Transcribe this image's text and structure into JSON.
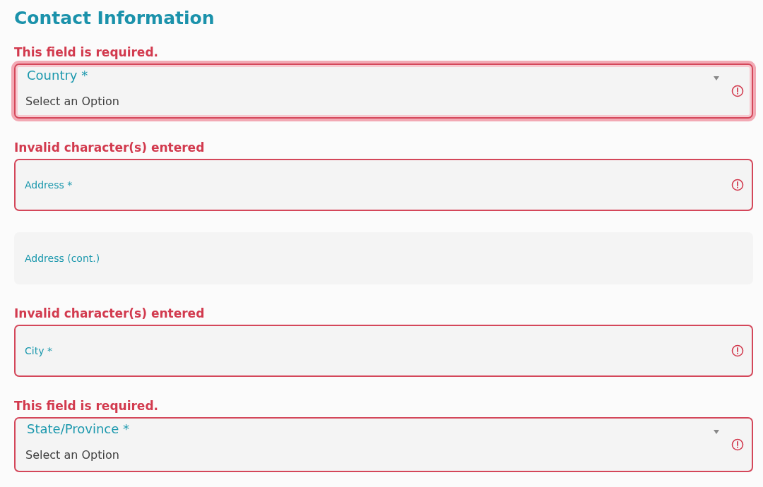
{
  "title": "Contact Information",
  "fields": [
    {
      "kind": "select",
      "label": "Country *",
      "value": "Select an Option",
      "error": "This field is required.",
      "focused": true
    },
    {
      "kind": "text",
      "label": "Address *",
      "error": "Invalid character(s) entered",
      "focused": false
    },
    {
      "kind": "text",
      "label": "Address (cont.)",
      "focused": false
    },
    {
      "kind": "text",
      "label": "City *",
      "error": "Invalid character(s) entered",
      "focused": false
    },
    {
      "kind": "select",
      "label": "State/Province *",
      "value": "Select an Option",
      "error": "This field is required.",
      "focused": false
    }
  ]
}
